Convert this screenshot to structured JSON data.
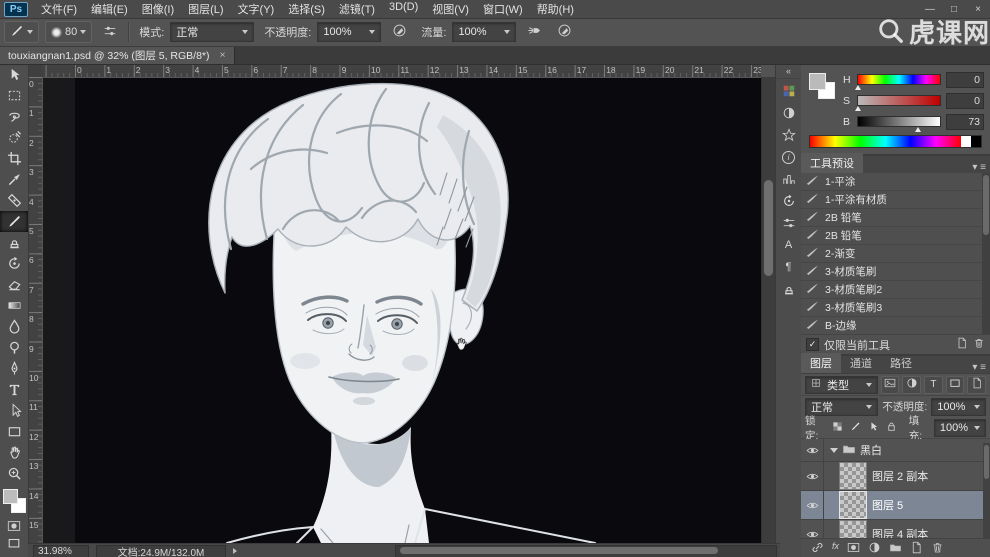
{
  "window": {
    "logo": "Ps",
    "menus": [
      "文件(F)",
      "编辑(E)",
      "图像(I)",
      "图层(L)",
      "文字(Y)",
      "选择(S)",
      "滤镜(T)",
      "3D(D)",
      "视图(V)",
      "窗口(W)",
      "帮助(H)"
    ],
    "menu_keys": [
      "file",
      "edit",
      "image",
      "layer",
      "type",
      "select",
      "filter",
      "3d",
      "view",
      "window",
      "help"
    ],
    "controls": {
      "minimize": "—",
      "restore": "□",
      "close": "×"
    }
  },
  "watermark": {
    "text": "虎课网"
  },
  "options": {
    "brush_size": "80",
    "mode_label": "模式:",
    "mode_value": "正常",
    "opacity_label": "不透明度:",
    "opacity_value": "100%",
    "flow_label": "流量:",
    "flow_value": "100%"
  },
  "tab": {
    "title": "touxiangnan1.psd @ 32% (图层 5, RGB/8*)",
    "close": "×"
  },
  "toolbar": {
    "tools": [
      {
        "name": "move"
      },
      {
        "name": "marquee"
      },
      {
        "name": "lasso"
      },
      {
        "name": "quick-selection"
      },
      {
        "name": "crop"
      },
      {
        "name": "eyedropper"
      },
      {
        "name": "healing"
      },
      {
        "name": "brush",
        "active": true
      },
      {
        "name": "stamp"
      },
      {
        "name": "history-brush"
      },
      {
        "name": "eraser"
      },
      {
        "name": "gradient"
      },
      {
        "name": "blur"
      },
      {
        "name": "dodge"
      },
      {
        "name": "pen"
      },
      {
        "name": "type"
      },
      {
        "name": "path-select"
      },
      {
        "name": "shape"
      },
      {
        "name": "hand"
      },
      {
        "name": "zoom"
      }
    ]
  },
  "rulers": {
    "top": [
      "0",
      "1",
      "2",
      "3",
      "4",
      "5",
      "6",
      "7",
      "8",
      "9",
      "10",
      "11",
      "12",
      "13",
      "14",
      "15",
      "16",
      "17",
      "18",
      "19",
      "20",
      "21",
      "22",
      "23"
    ],
    "left": [
      "0",
      "1",
      "2",
      "3",
      "4",
      "5",
      "6",
      "7",
      "8",
      "9",
      "10",
      "11",
      "12",
      "13",
      "14",
      "15"
    ]
  },
  "dock": {
    "icons": [
      {
        "name": "swatches-panel",
        "icon": "swatchgrid"
      },
      {
        "name": "adjustments-panel",
        "icon": "halfcircle"
      },
      {
        "name": "styles-panel",
        "icon": "star"
      },
      {
        "name": "info-panel",
        "glyph": "i"
      },
      {
        "name": "histogram-panel",
        "icon": "bars"
      },
      {
        "name": "history-panel",
        "icon": "history-brush"
      },
      {
        "name": "properties-panel",
        "icon": "sliders"
      },
      {
        "name": "character-panel",
        "glyph": "A"
      },
      {
        "name": "paragraph-panel",
        "glyph": "¶"
      },
      {
        "name": "clone-source-panel",
        "icon": "stamp"
      }
    ]
  },
  "panels": {
    "color": {
      "rows": [
        {
          "label": "H",
          "value": "0",
          "pos": 0
        },
        {
          "label": "S",
          "value": "0",
          "pos": 0
        },
        {
          "label": "B",
          "value": "73",
          "pos": 73
        }
      ]
    },
    "tool_presets": {
      "title": "工具预设",
      "items": [
        "1-平涂",
        "1-平涂有材质",
        "2B 铅笔",
        "2B 铅笔",
        "2-渐变",
        "3-材质笔刷",
        "3-材质笔刷2",
        "3-材质笔刷3",
        "B-边缘"
      ],
      "footer": {
        "label": "仅限当前工具",
        "checked": "✓"
      }
    },
    "layers": {
      "tabs": [
        "图层",
        "通道",
        "路径"
      ],
      "filter_label": "类型",
      "blend_mode": "正常",
      "opacity_label": "不透明度:",
      "opacity_value": "100%",
      "lock_label": "锁定:",
      "fill_label": "填充:",
      "fill_value": "100%",
      "rows": [
        {
          "type": "group",
          "name": "黑白"
        },
        {
          "type": "layer",
          "name": "图层 2 副本"
        },
        {
          "type": "layer",
          "name": "图层 5",
          "selected": true
        },
        {
          "type": "layer",
          "name": "图层 4 副本"
        }
      ]
    }
  },
  "status": {
    "zoom": "31.98%",
    "doc": "文档:24.9M/132.0M"
  }
}
